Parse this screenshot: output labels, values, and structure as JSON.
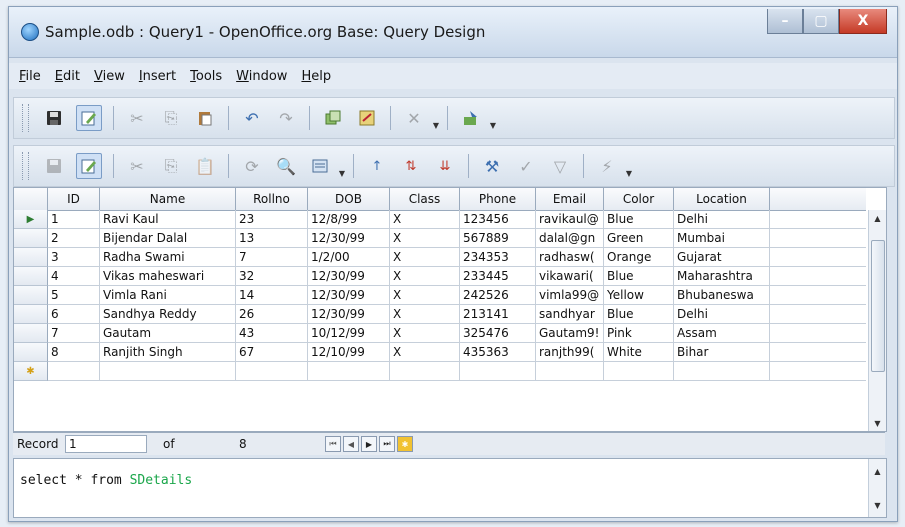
{
  "window": {
    "title": "Sample.odb : Query1 - OpenOffice.org Base: Query Design",
    "controls": [
      "–",
      "▢",
      "X"
    ]
  },
  "menu": [
    {
      "u": "F",
      "rest": "ile"
    },
    {
      "u": "E",
      "rest": "dit"
    },
    {
      "u": "V",
      "rest": "iew"
    },
    {
      "u": "I",
      "rest": "nsert"
    },
    {
      "u": "T",
      "rest": "ools"
    },
    {
      "u": "W",
      "rest": "indow"
    },
    {
      "u": "H",
      "rest": "elp"
    }
  ],
  "grid": {
    "columns": [
      "ID",
      "Name",
      "Rollno",
      "DOB",
      "Class",
      "Phone",
      "Email",
      "Color",
      "Location"
    ],
    "rows": [
      [
        "1",
        "Ravi Kaul",
        "23",
        "12/8/99",
        "X",
        "123456",
        "ravikaul@",
        "Blue",
        "Delhi"
      ],
      [
        "2",
        "Bijendar Dalal",
        "13",
        "12/30/99",
        "X",
        "567889",
        "dalal@gn",
        "Green",
        "Mumbai"
      ],
      [
        "3",
        "Radha Swami",
        "7",
        "1/2/00",
        "X",
        "234353",
        "radhasw(",
        "Orange",
        "Gujarat"
      ],
      [
        "4",
        "Vikas maheswari",
        "32",
        "12/30/99",
        "X",
        "233445",
        "vikawari(",
        "Blue",
        "Maharashtra"
      ],
      [
        "5",
        "Vimla Rani",
        "14",
        "12/30/99",
        "X",
        "242526",
        "vimla99@",
        "Yellow",
        "Bhubaneswa"
      ],
      [
        "6",
        "Sandhya Reddy",
        "26",
        "12/30/99",
        "X",
        "213141",
        "sandhyar",
        "Blue",
        "Delhi"
      ],
      [
        "7",
        "Gautam",
        "43",
        "10/12/99",
        "X",
        "325476",
        "Gautam9!",
        "Pink",
        "Assam"
      ],
      [
        "8",
        "Ranjith Singh",
        "67",
        "12/10/99",
        "X",
        "435363",
        "ranjth99(",
        "White",
        "Bihar"
      ]
    ],
    "current_row_marker": "▶"
  },
  "navigator": {
    "record_label": "Record",
    "record_value": "1",
    "of_label": "of",
    "total": "8"
  },
  "sql": {
    "prefix": "select * from ",
    "table": "SDetails"
  },
  "icons": {
    "toolbar1": [
      "save-icon",
      "edit-mode-icon",
      "cut-icon",
      "copy-icon",
      "paste-icon",
      "undo-icon",
      "redo-icon",
      "add-tables-icon",
      "design-view-icon",
      "clear-query-icon",
      "run-query-icon"
    ],
    "toolbar2": [
      "save-record-icon",
      "edit-data-icon",
      "cut-icon",
      "copy-icon",
      "paste-icon",
      "refresh-icon",
      "find-icon",
      "data-to-text-icon",
      "sort-ascending-icon",
      "sort-descending-icon",
      "sort-icon",
      "autofilter-icon",
      "standard-filter-icon",
      "remove-filter-icon",
      "apply-filter-icon"
    ]
  }
}
